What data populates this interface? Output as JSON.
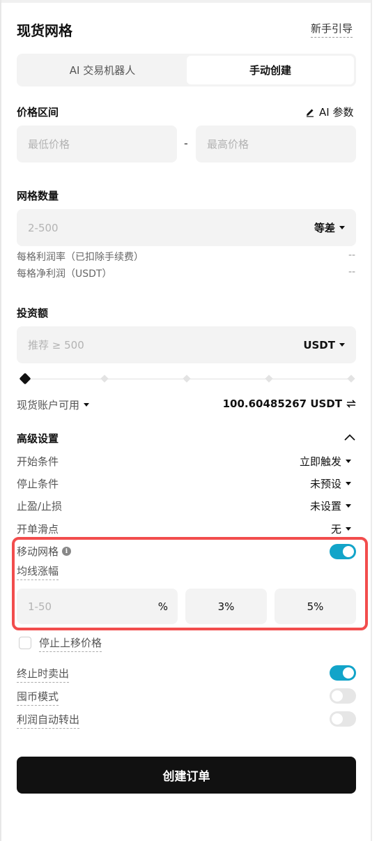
{
  "header": {
    "title": "现货网格",
    "guide_link": "新手引导"
  },
  "tabs": [
    {
      "label": "AI 交易机器人",
      "active": false
    },
    {
      "label": "手动创建",
      "active": true
    }
  ],
  "price_range": {
    "label": "价格区间",
    "ai_param_label": "AI 参数",
    "min_placeholder": "最低价格",
    "separator": "-",
    "max_placeholder": "最高价格"
  },
  "grid_count": {
    "label": "网格数量",
    "placeholder": "2-500",
    "mode": "等差",
    "profit_rate_label": "每格利润率（已扣除手续费）",
    "profit_rate_value": "--",
    "net_profit_label": "每格净利润（USDT）",
    "net_profit_value": "--"
  },
  "investment": {
    "label": "投资额",
    "placeholder": "推荐 ≥ 500",
    "currency": "USDT",
    "slider_percent": 0,
    "available_label": "现货账户可用",
    "available_value": "100.60485267 USDT"
  },
  "advanced": {
    "label": "高级设置",
    "rows": [
      {
        "label": "开始条件",
        "value": "立即触发"
      },
      {
        "label": "停止条件",
        "value": "未预设"
      },
      {
        "label": "止盈/止损",
        "value": "未设置"
      },
      {
        "label": "开单滑点",
        "value": "无"
      }
    ],
    "moving_grid": {
      "label": "移动网格",
      "enabled": true,
      "ma_label": "均线涨幅",
      "input_placeholder": "1-50",
      "unit": "%",
      "preset_1": "3%",
      "preset_2": "5%"
    },
    "stop_upward_label": "停止上移价格",
    "sell_on_stop": {
      "label": "终止时卖出",
      "enabled": true
    },
    "coin_mode": {
      "label": "囤币模式",
      "enabled": false
    },
    "auto_transfer": {
      "label": "利润自动转出",
      "enabled": false
    }
  },
  "submit_label": "创建订单",
  "colors": {
    "accent": "#12a4c9",
    "highlight_border": "#f24d4d",
    "button_bg": "#111111",
    "field_bg": "#f3f3f3"
  }
}
